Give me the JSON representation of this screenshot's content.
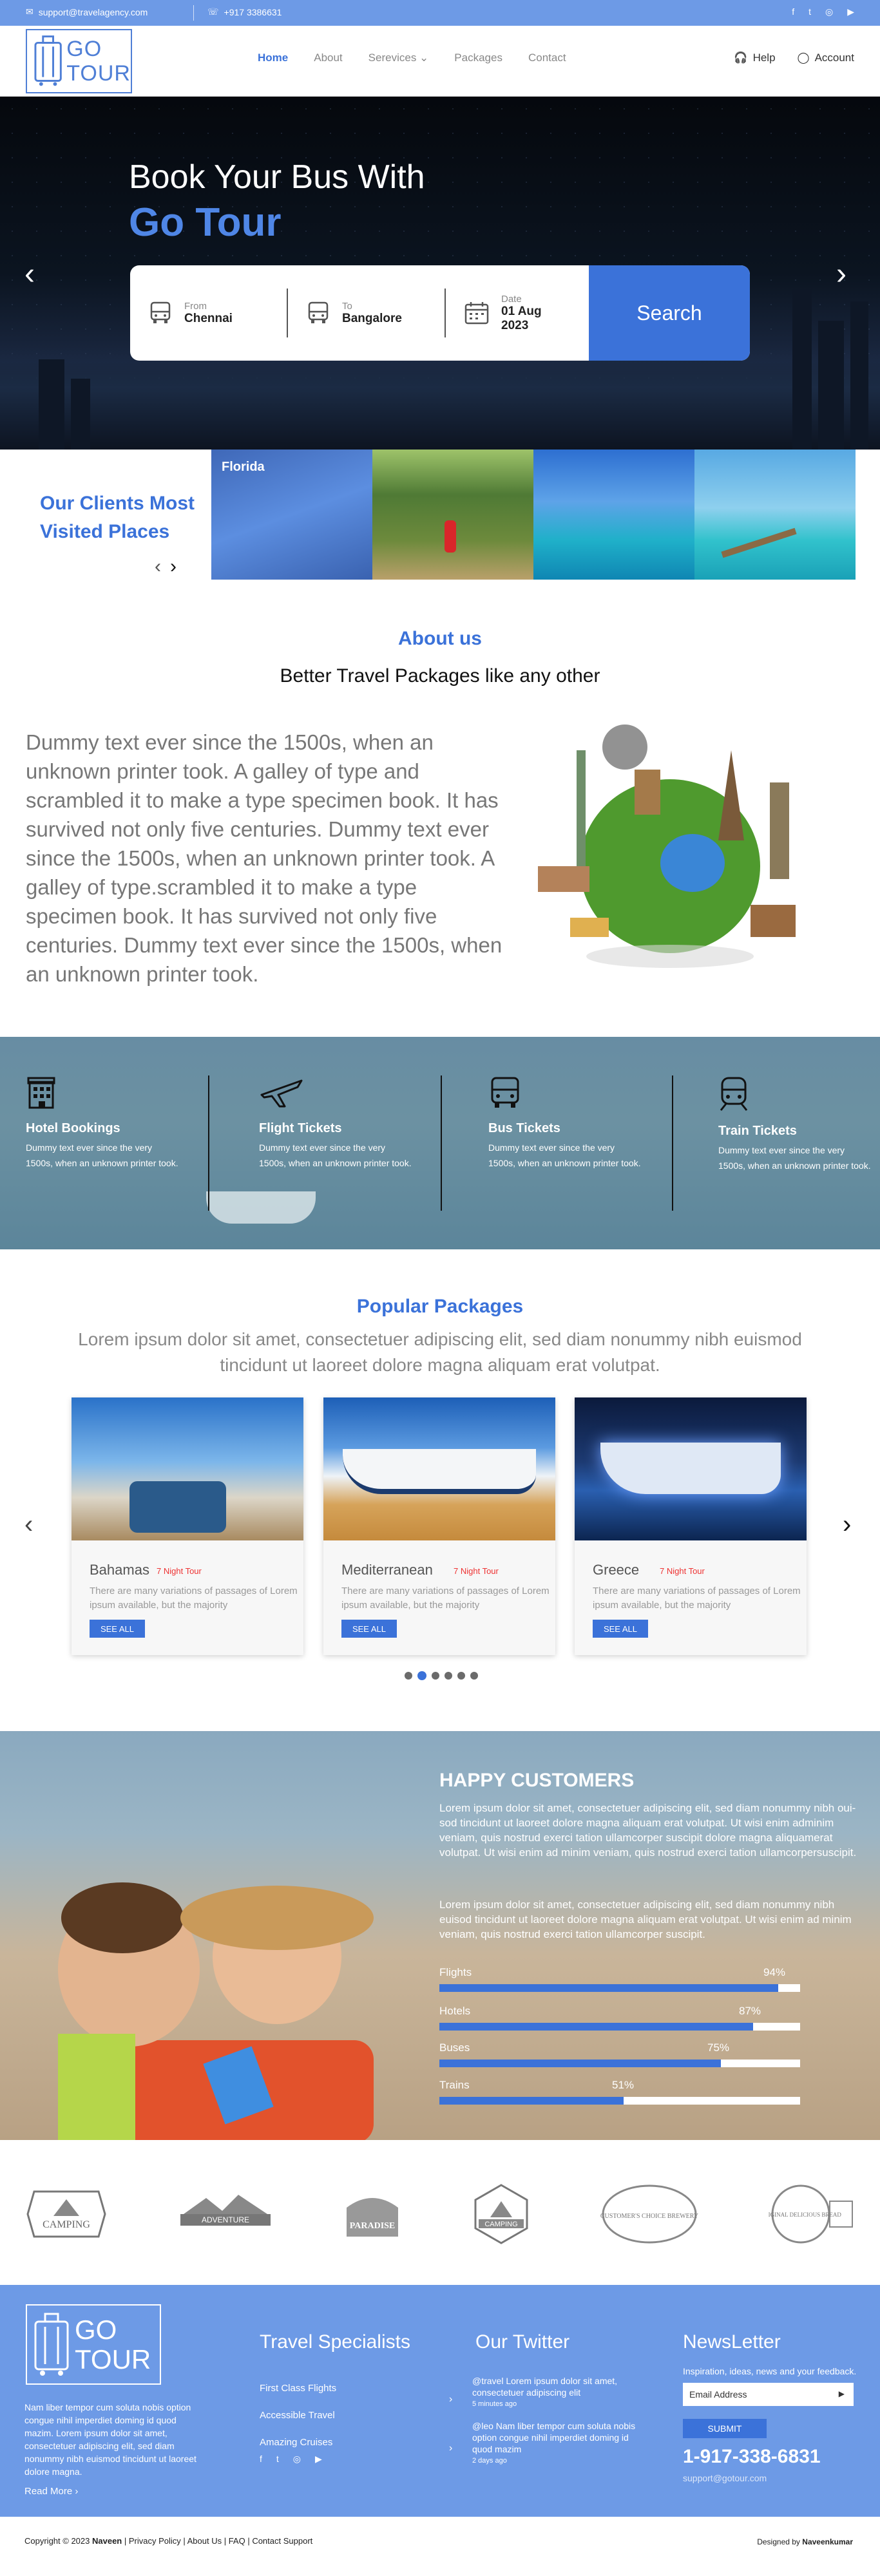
{
  "topbar": {
    "email": "support@travelagency.com",
    "phone": "+917 3386631",
    "social": [
      "f",
      "t",
      "◎",
      "▶"
    ]
  },
  "brand": {
    "logo_line1": "GO",
    "logo_line2": "TOUR"
  },
  "nav": {
    "items": [
      "Home",
      "About",
      "Serevices",
      "Packages",
      "Contact"
    ],
    "help": "Help",
    "account": "Account"
  },
  "hero": {
    "title": "Book Your Bus With",
    "brand": "Go Tour",
    "from_label": "From",
    "from_value": "Chennai",
    "to_label": "To",
    "to_value": "Bangalore",
    "date_label": "Date",
    "date_value": "01 Aug 2023",
    "search_button": "Search"
  },
  "clients": {
    "title": "Our Clients Most Visited Places",
    "tile_caption": "Florida"
  },
  "about": {
    "heading": "About us",
    "subheading": "Better Travel Packages like any other",
    "text": "Dummy text ever since the 1500s, when an unknown printer took. A galley of type and scrambled it to make a type specimen book. It has survived not only five centuries. Dummy text ever since the 1500s, when an unknown printer took. A galley of type.scrambled it to make a type specimen book. It has survived not only five centuries. Dummy text ever since the 1500s, when an unknown printer took."
  },
  "services": [
    {
      "name": "Hotel Bookings",
      "icon": "hotel-icon",
      "desc": "Dummy text ever since the very 1500s, when an unknown printer took."
    },
    {
      "name": "Flight Tickets",
      "icon": "plane-icon",
      "desc": "Dummy text ever since the very 1500s, when an unknown printer took."
    },
    {
      "name": "Bus Tickets",
      "icon": "bus-icon",
      "desc": "Dummy text ever since the very 1500s, when an unknown printer took."
    },
    {
      "name": "Train Tickets",
      "icon": "train-icon",
      "desc": "Dummy text ever since the very 1500s, when an unknown printer took."
    }
  ],
  "packages": {
    "heading": "Popular Packages",
    "intro": "Lorem ipsum dolor sit amet, consectetuer adipiscing elit, sed diam nonummy nibh euismod tincidunt ut laoreet dolore magna aliquam erat volutpat.",
    "cards": [
      {
        "name": "Bahamas",
        "nights": "7 Night Tour",
        "desc": "There are many variations of passages of Lorem ipsum available, but the majority",
        "button": "SEE ALL"
      },
      {
        "name": "Mediterranean",
        "nights": "7 Night Tour",
        "desc": "There are many variations of passages of Lorem ipsum available, but the majority",
        "button": "SEE ALL"
      },
      {
        "name": "Greece",
        "nights": "7 Night Tour",
        "desc": "There are many variations of passages of Lorem ipsum available, but the majority",
        "button": "SEE ALL"
      }
    ],
    "dots_active": 1
  },
  "happy": {
    "heading": "HAPPY CUSTOMERS",
    "para1": "Lorem ipsum dolor sit amet, consectetuer adipiscing elit, sed diam nonummy nibh oui- sod tincidunt ut laoreet dolore magna aliquam erat volutpat. Ut wisi enim adminim veniam, quis nostrud exerci tation ullamcorper suscipit dolore magna aliquamerat volutpat. Ut wisi enim ad minim veniam, quis nostrud exerci tation ullamcorpersuscipit.",
    "para2": "Lorem ipsum dolor sit amet, consectetuer adipiscing elit, sed diam nonummy nibh euisod tincidunt ut laoreet dolore magna aliquam erat volutpat. Ut wisi enim ad minim veniam, quis nostrud exerci tation ullamcorper suscipit.",
    "bars": [
      {
        "label": "Flights",
        "pct": "94%",
        "value": 0.94
      },
      {
        "label": "Hotels",
        "pct": "87%",
        "value": 0.87
      },
      {
        "label": "Buses",
        "pct": "75%",
        "value": 0.78
      },
      {
        "label": "Trains",
        "pct": "51%",
        "value": 0.51
      }
    ]
  },
  "brands": [
    "CAMPING",
    "ADVENTURE",
    "PARADISE",
    "CAMPING",
    "CUSTOMER'S CHOICE BREWERY",
    "ORIGINAL DELICIOUS BREAD"
  ],
  "footer": {
    "about": "Nam liber tempor cum soluta nobis option congue nihil imperdiet doming id quod mazim. Lorem ipsum dolor sit amet, consectetuer adipiscing elit, sed diam nonummy nibh euismod tincidunt ut laoreet dolore magna.",
    "read_more": "Read More ›",
    "col1_title": "Travel Specialists",
    "col1_links": [
      "First Class Flights",
      "Accessible Travel",
      "Amazing Cruises"
    ],
    "col2_title": "Our Twitter",
    "tweets": [
      {
        "text": "@travel Lorem ipsum dolor sit amet, consectetuer adipiscing elit",
        "time": "5 minutes ago"
      },
      {
        "text": "@leo Nam liber tempor cum soluta nobis option congue nihil imperdiet doming id quod mazim",
        "time": "2 days ago"
      }
    ],
    "col3_title": "NewsLetter",
    "nl_sub": "Inspiration, ideas, news and your feedback.",
    "nl_placeholder": "Email Address",
    "nl_button": "SUBMIT",
    "phone": "1-917-338-6831",
    "email": "support@gotour.com"
  },
  "copyright": {
    "left": "Copyright © 2023",
    "owner": "Naveen",
    "links": "| Privacy Policy | About Us | FAQ | Contact Support",
    "right_prefix": "Designed by",
    "right_name": "Naveenkumar"
  },
  "colors": {
    "accent": "#3b72d9",
    "topbar": "#6d9ae6"
  }
}
